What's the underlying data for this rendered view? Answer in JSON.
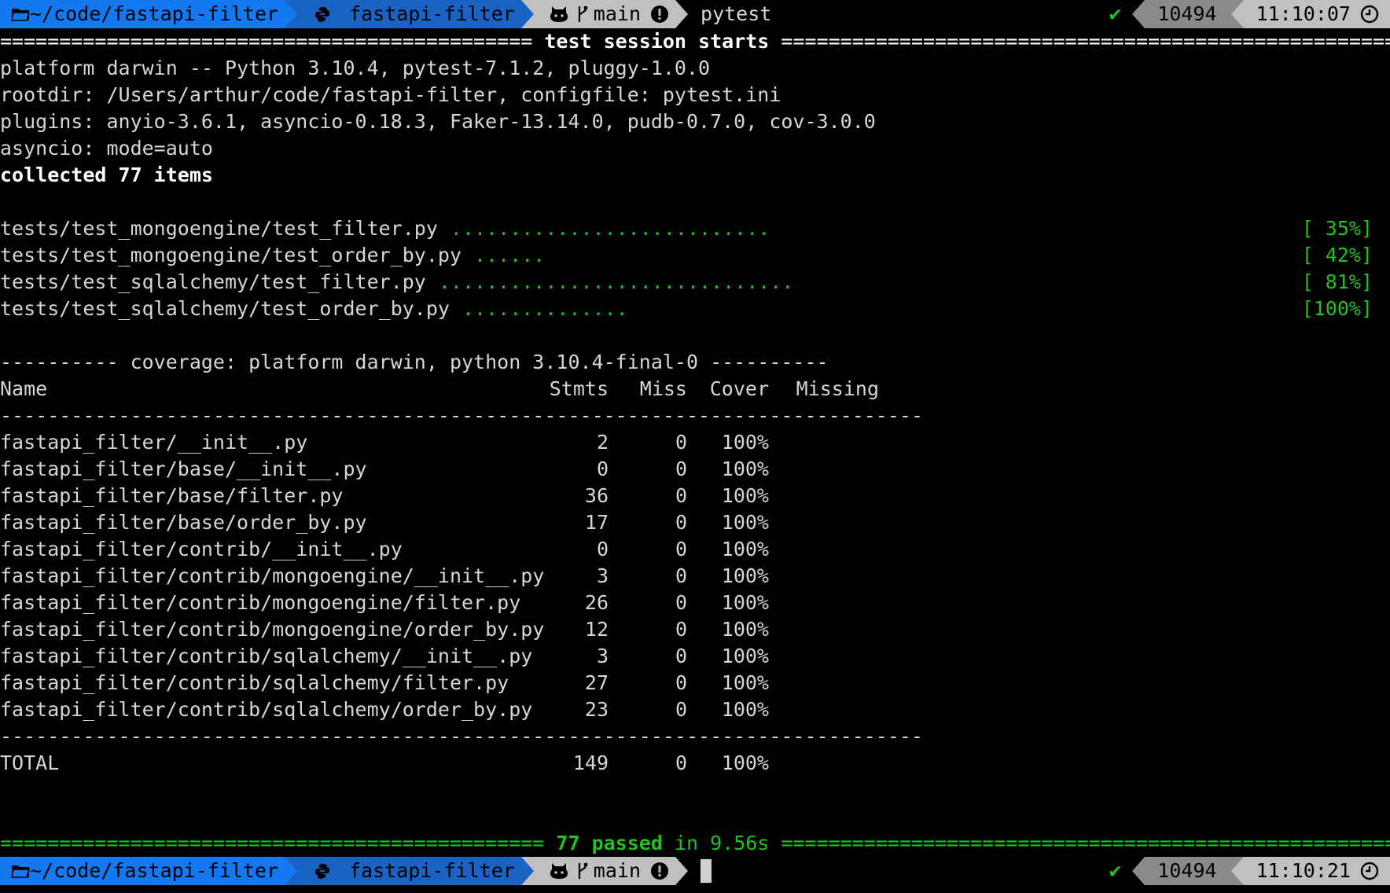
{
  "prompt_top": {
    "dir": "~/code/fastapi-filter",
    "venv": "fastapi-filter",
    "branch": "main",
    "command": "pytest",
    "history": "10494",
    "time": "11:10:07"
  },
  "session": {
    "header": "test session starts",
    "info_lines": [
      "platform darwin -- Python 3.10.4, pytest-7.1.2, pluggy-1.0.0",
      "rootdir: /Users/arthur/code/fastapi-filter, configfile: pytest.ini",
      "plugins: anyio-3.6.1, asyncio-0.18.3, Faker-13.14.0, pudb-0.7.0, cov-3.0.0",
      "asyncio: mode=auto"
    ],
    "collected": "collected 77 items"
  },
  "test_files": [
    {
      "file": "tests/test_mongoengine/test_filter.py",
      "dots": "...........................",
      "pct": "[ 35%]"
    },
    {
      "file": "tests/test_mongoengine/test_order_by.py",
      "dots": "......",
      "pct": "[ 42%]"
    },
    {
      "file": "tests/test_sqlalchemy/test_filter.py",
      "dots": "..............................",
      "pct": "[ 81%]"
    },
    {
      "file": "tests/test_sqlalchemy/test_order_by.py",
      "dots": "..............",
      "pct": "[100%]"
    }
  ],
  "coverage": {
    "title": "---------- coverage: platform darwin, python 3.10.4-final-0 ----------",
    "headers": [
      "Name",
      "Stmts",
      "Miss",
      "Cover",
      "Missing"
    ],
    "rows": [
      {
        "name": "fastapi_filter/__init__.py",
        "stmts": "2",
        "miss": "0",
        "cover": "100%"
      },
      {
        "name": "fastapi_filter/base/__init__.py",
        "stmts": "0",
        "miss": "0",
        "cover": "100%"
      },
      {
        "name": "fastapi_filter/base/filter.py",
        "stmts": "36",
        "miss": "0",
        "cover": "100%"
      },
      {
        "name": "fastapi_filter/base/order_by.py",
        "stmts": "17",
        "miss": "0",
        "cover": "100%"
      },
      {
        "name": "fastapi_filter/contrib/__init__.py",
        "stmts": "0",
        "miss": "0",
        "cover": "100%"
      },
      {
        "name": "fastapi_filter/contrib/mongoengine/__init__.py",
        "stmts": "3",
        "miss": "0",
        "cover": "100%"
      },
      {
        "name": "fastapi_filter/contrib/mongoengine/filter.py",
        "stmts": "26",
        "miss": "0",
        "cover": "100%"
      },
      {
        "name": "fastapi_filter/contrib/mongoengine/order_by.py",
        "stmts": "12",
        "miss": "0",
        "cover": "100%"
      },
      {
        "name": "fastapi_filter/contrib/sqlalchemy/__init__.py",
        "stmts": "3",
        "miss": "0",
        "cover": "100%"
      },
      {
        "name": "fastapi_filter/contrib/sqlalchemy/filter.py",
        "stmts": "27",
        "miss": "0",
        "cover": "100%"
      },
      {
        "name": "fastapi_filter/contrib/sqlalchemy/order_by.py",
        "stmts": "23",
        "miss": "0",
        "cover": "100%"
      }
    ],
    "total": {
      "name": "TOTAL",
      "stmts": "149",
      "miss": "0",
      "cover": "100%"
    }
  },
  "summary": {
    "passed": "77 passed",
    "duration": "in 9.56s"
  },
  "prompt_bottom": {
    "dir": "~/code/fastapi-filter",
    "venv": "fastapi-filter",
    "branch": "main",
    "history": "10494",
    "time": "11:10:21"
  },
  "colors": {
    "background": "#000000",
    "text": "#d6d6d6",
    "green": "#21c21d",
    "dir_segment": "#1478f0",
    "venv_segment": "#1a63c4",
    "git_segment": "#c0c0c0",
    "history_segment": "#8a8a8a"
  },
  "icons": [
    "folder-icon",
    "python-icon",
    "github-icon",
    "branch-icon",
    "warning-icon",
    "check-icon",
    "clock-icon"
  ]
}
